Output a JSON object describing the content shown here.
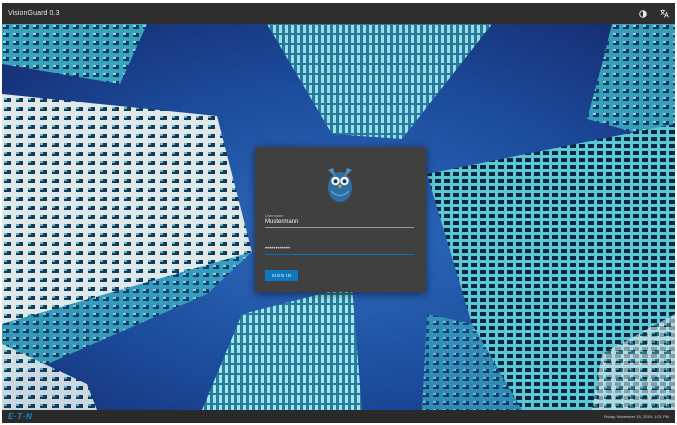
{
  "app": {
    "title": "VisionGuard 0.3"
  },
  "toolbar": {
    "theme_icon": "contrast-icon",
    "language_icon": "translate-icon"
  },
  "login": {
    "logo_icon": "owl-logo",
    "username": {
      "label": "Username",
      "value": "Mustermann"
    },
    "password": {
      "placeholder": "••••••••••••"
    },
    "signin_label": "SIGN IN"
  },
  "footer": {
    "brand": "E·T·N",
    "timestamp": "Friday, November 15, 2019, 1:01 PM"
  },
  "colors": {
    "accent": "#0c78bd",
    "topbar": "#2e2e2e",
    "card": "#404040",
    "sky": "#1a4fa0"
  }
}
